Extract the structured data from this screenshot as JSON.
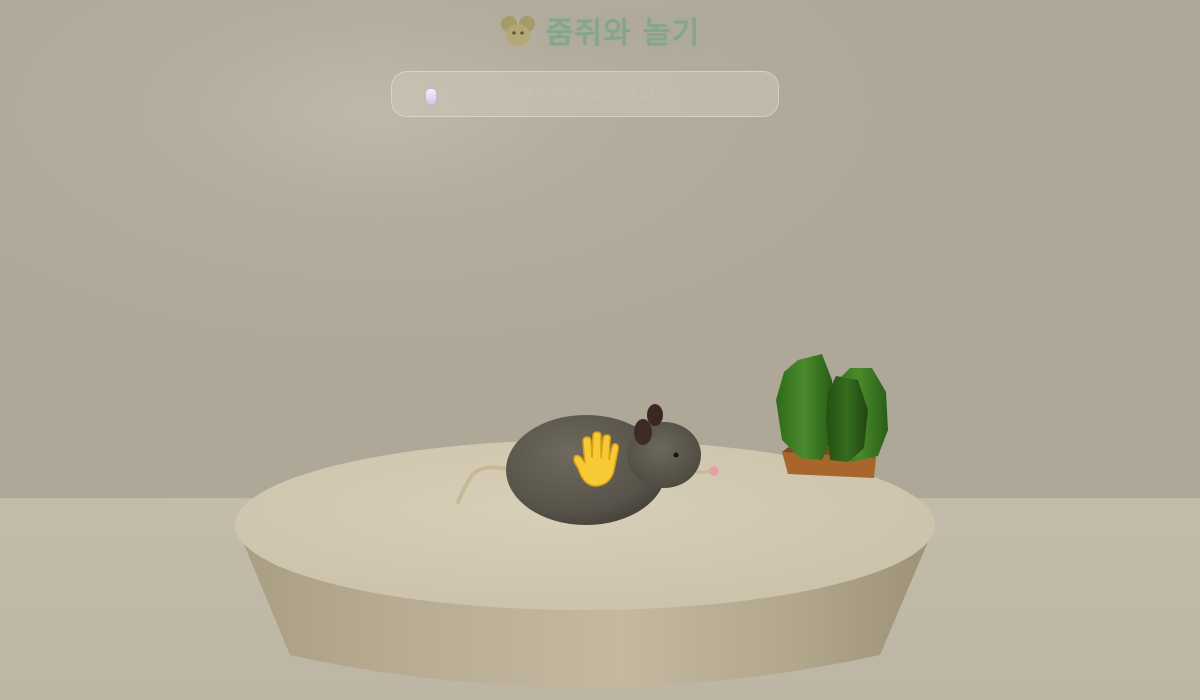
{
  "title": {
    "text": "줌쥐와 놀기",
    "icon": "mouse-head-icon"
  },
  "hint": {
    "icon": "computer-mouse-icon",
    "text": "아이템을 클릭해서 줌쥐와 놀아주세요!"
  },
  "cursor": {
    "icon": "open-hand-icon"
  },
  "colors": {
    "wall": "#b1aa9a",
    "floor": "#c0b8a6",
    "table_top": "#d2c8b2",
    "mouse_body": "#595448",
    "cactus": "#3e7a22",
    "title": "#86a58a"
  }
}
